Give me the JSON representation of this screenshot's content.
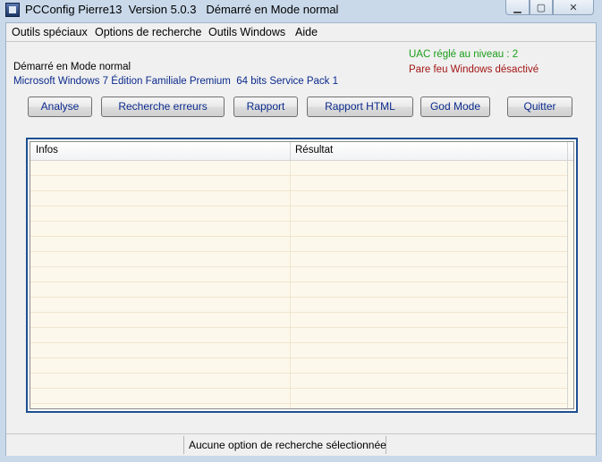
{
  "window": {
    "title": "PCConfig Pierre13  Version 5.0.3   Démarré en Mode normal",
    "controls": {
      "minimize": "▁",
      "maximize": "▢",
      "close": "✕"
    }
  },
  "menu": [
    "Outils spéciaux",
    "Options de recherche",
    "Outils Windows",
    "Aide"
  ],
  "system": {
    "mode": "Démarré en Mode normal",
    "os": "Microsoft Windows 7 Édition Familiale Premium  64 bits Service Pack 1",
    "uac": "UAC réglé au niveau : 2",
    "firewall": "Pare feu Windows désactivé"
  },
  "toolbar": {
    "analyse": "Analyse",
    "recherche": "Recherche erreurs",
    "rapport": "Rapport",
    "rapport_html": "Rapport HTML",
    "god_mode": "God Mode",
    "quitter": "Quitter"
  },
  "grid": {
    "columns": [
      "Infos",
      "Résultat"
    ]
  },
  "status": {
    "search_option": "Aucune option de recherche sélectionnée"
  },
  "colors": {
    "uac": "#1a9e1a",
    "firewall": "#a31515",
    "button_text": "#0b2a8c",
    "grid_background": "#fdf8ec",
    "grid_border": "#1d4f91"
  },
  "icons": {
    "app": "pcconfig-app-icon"
  }
}
